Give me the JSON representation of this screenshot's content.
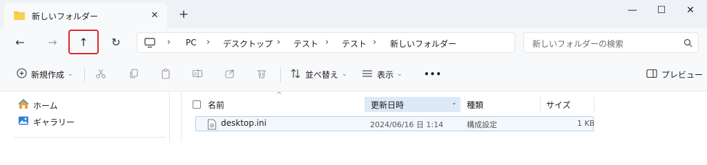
{
  "window": {
    "tab_title": "新しいフォルダー",
    "tab_close": "✕",
    "new_tab": "+",
    "minimize": "—",
    "maximize": "☐",
    "close": "✕"
  },
  "nav": {
    "back": "←",
    "forward": "→",
    "up": "↑",
    "refresh": "↻"
  },
  "address": {
    "crumbs": [
      "PC",
      "デスクトップ",
      "テスト",
      "テスト",
      "新しいフォルダー"
    ],
    "separator": "›"
  },
  "search": {
    "placeholder": "新しいフォルダーの検索"
  },
  "toolbar": {
    "new_label": "新規作成",
    "sort_label": "並べ替え",
    "view_label": "表示",
    "more_label": "•••",
    "preview_label": "プレビュー"
  },
  "navpane": {
    "items": [
      {
        "label": "ホーム",
        "icon": "home-icon"
      },
      {
        "label": "ギャラリー",
        "icon": "gallery-icon"
      }
    ]
  },
  "table": {
    "columns": [
      "名前",
      "更新日時",
      "種類",
      "サイズ"
    ],
    "sort_caret": "^",
    "rows": [
      {
        "name": "desktop.ini",
        "modified": "2024/06/16 日 1:14",
        "type": "構成設定",
        "size": "1 KB"
      }
    ]
  },
  "colors": {
    "highlight_border": "#e0242a",
    "folder": "#f4c542",
    "sorted_column": "#dde9f7"
  }
}
